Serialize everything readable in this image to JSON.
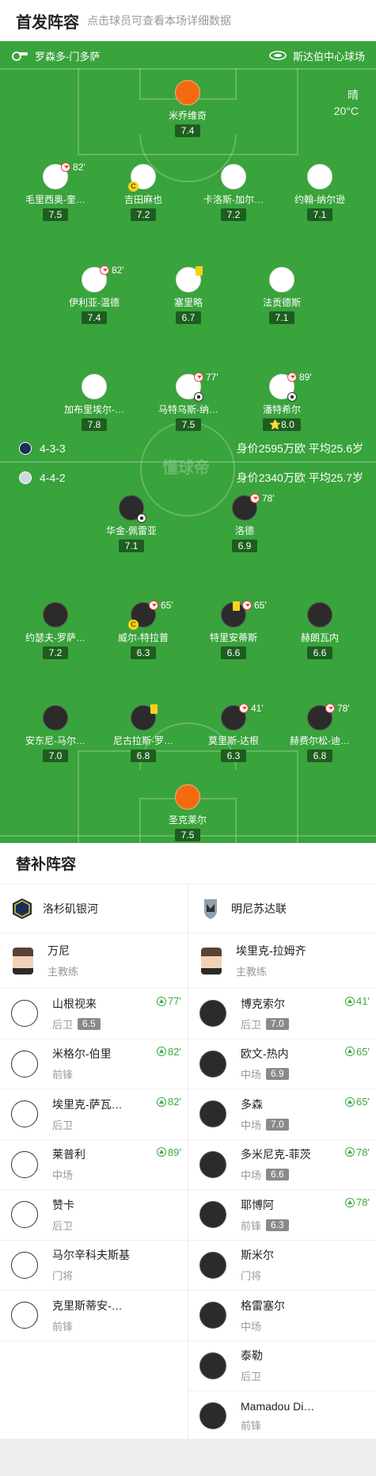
{
  "header": {
    "title": "首发阵容",
    "subtitle": "点击球员可查看本场详细数据"
  },
  "match_info": {
    "referee": "罗森多-门多萨",
    "venue": "斯达伯中心球场",
    "weather": "晴",
    "temperature": "20°C"
  },
  "watermark": "懂球帝",
  "home": {
    "formation": "4-3-3",
    "value_summary": "身价2595万欧 平均25.6岁",
    "players": [
      {
        "name": "米乔维奇",
        "rating": "7.4"
      },
      {
        "name": "毛里西奥-奎…",
        "rating": "7.5",
        "sub_minute": "82'"
      },
      {
        "name": "吉田麻也",
        "rating": "7.2",
        "captain": "C"
      },
      {
        "name": "卡洛斯-加尔…",
        "rating": "7.2"
      },
      {
        "name": "约翰-纳尔逊",
        "rating": "7.1"
      },
      {
        "name": "伊利亚-温德",
        "rating": "7.4",
        "sub_minute": "82'"
      },
      {
        "name": "塞里略",
        "rating": "6.7"
      },
      {
        "name": "法贡德斯",
        "rating": "7.1"
      },
      {
        "name": "加布里埃尔-…",
        "rating": "7.8"
      },
      {
        "name": "马特乌斯-纳…",
        "rating": "7.5",
        "sub_minute": "77'"
      },
      {
        "name": "潘特希尔",
        "rating": "8.0",
        "sub_minute": "89'",
        "best": "⭐"
      }
    ]
  },
  "away": {
    "formation": "4-4-2",
    "value_summary": "身价2340万欧 平均25.7岁",
    "players": [
      {
        "name": "华金-佩雷亚",
        "rating": "7.1"
      },
      {
        "name": "洛德",
        "rating": "6.9",
        "sub_minute": "78'"
      },
      {
        "name": "约瑟夫-罗萨…",
        "rating": "7.2"
      },
      {
        "name": "威尔-特拉普",
        "rating": "6.3",
        "sub_minute": "65'",
        "captain": "C"
      },
      {
        "name": "特里安蒂斯",
        "rating": "6.6",
        "sub_minute": "65'"
      },
      {
        "name": "赫朗瓦内",
        "rating": "6.6"
      },
      {
        "name": "安东尼-马尔…",
        "rating": "7.0"
      },
      {
        "name": "尼古拉斯-罗…",
        "rating": "6.8"
      },
      {
        "name": "莫里斯-达根",
        "rating": "6.3",
        "sub_minute": "41'"
      },
      {
        "name": "赫费尔松-迪…",
        "rating": "6.8",
        "sub_minute": "78'"
      },
      {
        "name": "圣克莱尔",
        "rating": "7.5"
      }
    ]
  },
  "bench": {
    "title": "替补阵容",
    "left": {
      "team": "洛杉矶银河",
      "coach": {
        "name": "万尼",
        "role": "主教练"
      },
      "players": [
        {
          "name": "山根视来",
          "position": "后卫",
          "rating": "6.5",
          "in_minute": "77'"
        },
        {
          "name": "米格尔-伯里",
          "position": "前锋",
          "in_minute": "82'"
        },
        {
          "name": "埃里克-萨瓦…",
          "position": "后卫",
          "in_minute": "82'"
        },
        {
          "name": "莱普利",
          "position": "中场",
          "in_minute": "89'"
        },
        {
          "name": "赞卡",
          "position": "后卫"
        },
        {
          "name": "马尔辛科夫斯基",
          "position": "门将"
        },
        {
          "name": "克里斯蒂安-…",
          "position": "前锋"
        }
      ]
    },
    "right": {
      "team": "明尼苏达联",
      "coach": {
        "name": "埃里克-拉姆齐",
        "role": "主教练"
      },
      "players": [
        {
          "name": "博克索尔",
          "position": "后卫",
          "rating": "7.0",
          "in_minute": "41'"
        },
        {
          "name": "欧文-热内",
          "position": "中场",
          "rating": "6.9",
          "in_minute": "65'"
        },
        {
          "name": "多森",
          "position": "中场",
          "rating": "7.0",
          "in_minute": "65'"
        },
        {
          "name": "多米尼克-菲茨",
          "position": "中场",
          "rating": "6.6",
          "in_minute": "78'"
        },
        {
          "name": "耶博阿",
          "position": "前锋",
          "rating": "6.3",
          "in_minute": "78'"
        },
        {
          "name": "斯米尔",
          "position": "门将"
        },
        {
          "name": "格雷塞尔",
          "position": "中场"
        },
        {
          "name": "泰勒",
          "position": "后卫"
        },
        {
          "name": "Mamadou Di…",
          "position": "前锋"
        }
      ]
    }
  },
  "colors": {
    "pitch": "#39a33c",
    "home_kit": "#ffffff",
    "away_kit": "#2b2b2b",
    "goalkeeper": "#f56a10",
    "rating_bg": "#1e5d20",
    "sub_in": "#3cab3f"
  }
}
